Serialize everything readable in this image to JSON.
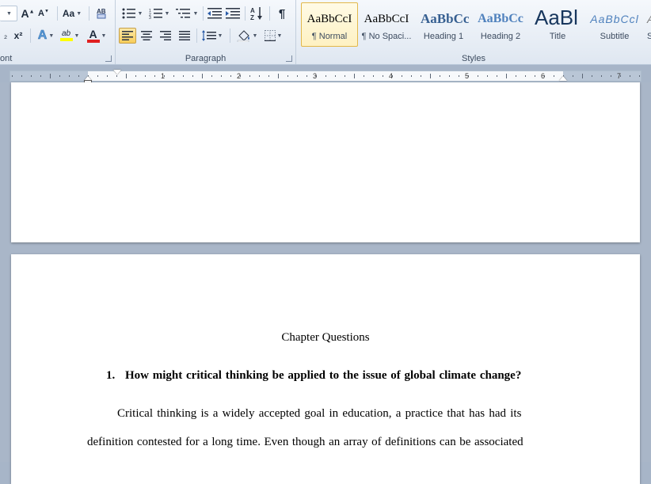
{
  "ribbon": {
    "font_group_label": "ont",
    "paragraph_group_label": "Paragraph",
    "styles_group_label": "Styles",
    "font_size_label": "Aa",
    "subscript": "₂",
    "superscript": "x²",
    "text_effects": "A",
    "highlight": "ab",
    "font_color_letter": "A",
    "font_color": "#e02020",
    "highlight_color": "#ffff00",
    "pilcrow": "¶",
    "sort_label": "A↓Z",
    "styles": [
      {
        "sample": "AaBbCcI",
        "name": "¶ Normal",
        "selected": true
      },
      {
        "sample": "AaBbCcI",
        "name": "¶ No Spaci...",
        "selected": false
      },
      {
        "sample": "AaBbCc",
        "name": "Heading 1",
        "selected": false
      },
      {
        "sample": "AaBbCc",
        "name": "Heading 2",
        "selected": false
      },
      {
        "sample": "AaBl",
        "name": "Title",
        "selected": false
      },
      {
        "sample": "AaBbCcl",
        "name": "Subtitle",
        "selected": false
      },
      {
        "sample": "A",
        "name": "S",
        "selected": false
      }
    ]
  },
  "ruler": {
    "numbers": [
      "1",
      "2",
      "3",
      "4",
      "5",
      "6",
      "7"
    ]
  },
  "document": {
    "title": "Chapter Questions",
    "question_number": "1.",
    "question_text": "How might critical thinking be applied to the issue of global climate change?",
    "para_line1": "Critical thinking is a widely accepted goal in education, a practice that has had its",
    "para_line2": "definition contested for a long time. Even though an array of definitions can be associated"
  }
}
